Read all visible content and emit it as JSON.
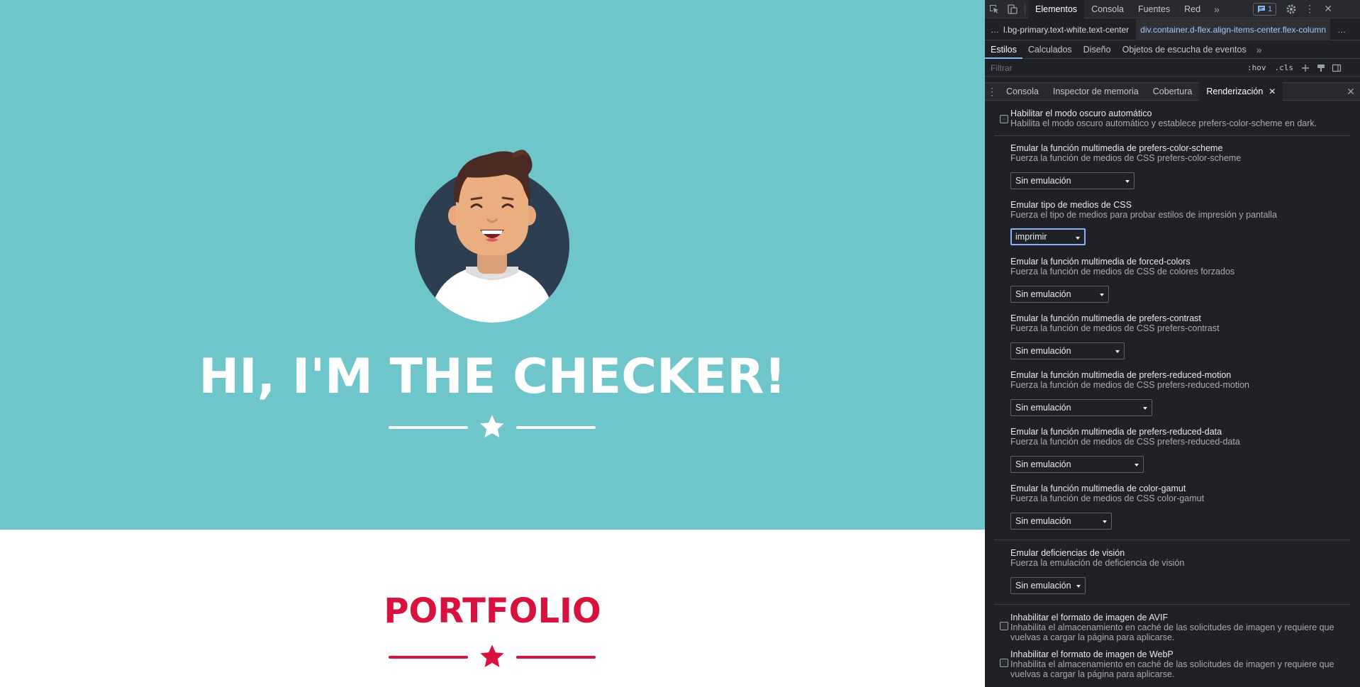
{
  "page": {
    "hero_title": "HI, I'M THE CHECKER!",
    "section_title": "PORTFOLIO",
    "colors": {
      "masthead": "#6ec6ca",
      "accent": "#d7123e",
      "text_light": "#ffffff"
    }
  },
  "devtools": {
    "top_tabs": [
      "Elementos",
      "Consola",
      "Fuentes",
      "Red"
    ],
    "issues_count": "1",
    "breadcrumb": {
      "lead": "…",
      "item1": "l.bg-primary.text-white.text-center",
      "item2": "div.container.d-flex.align-items-center.flex-column",
      "trail": "…"
    },
    "style_tabs": [
      "Estilos",
      "Calculados",
      "Diseño",
      "Objetos de escucha de eventos"
    ],
    "filter_placeholder": "Filtrar",
    "filter_tools": {
      "hov": ":hov",
      "cls": ".cls"
    },
    "drawer_tabs": [
      "Consola",
      "Inspector de memoria",
      "Cobertura",
      "Renderización"
    ],
    "rendering": {
      "auto_dark": {
        "title": "Habilitar el modo oscuro automático",
        "desc": "Habilita el modo oscuro automático y establece prefers-color-scheme en dark."
      },
      "color_scheme": {
        "title": "Emular la función multimedia de prefers-color-scheme",
        "desc": "Fuerza la función de medios de CSS prefers-color-scheme",
        "value": "Sin emulación"
      },
      "media_type": {
        "title": "Emular tipo de medios de CSS",
        "desc": "Fuerza el tipo de medios para probar estilos de impresión y pantalla",
        "value": "imprimir"
      },
      "forced_colors": {
        "title": "Emular la función multimedia de forced-colors",
        "desc": "Fuerza la función de medios de CSS de colores forzados",
        "value": "Sin emulación"
      },
      "contrast": {
        "title": "Emular la función multimedia de prefers-contrast",
        "desc": "Fuerza la función de medios de CSS prefers-contrast",
        "value": "Sin emulación"
      },
      "reduced_motion": {
        "title": "Emular la función multimedia de prefers-reduced-motion",
        "desc": "Fuerza la función de medios de CSS prefers-reduced-motion",
        "value": "Sin emulación"
      },
      "reduced_data": {
        "title": "Emular la función multimedia de prefers-reduced-data",
        "desc": "Fuerza la función de medios de CSS prefers-reduced-data",
        "value": "Sin emulación"
      },
      "color_gamut": {
        "title": "Emular la función multimedia de color-gamut",
        "desc": "Fuerza la función de medios de CSS color-gamut",
        "value": "Sin emulación"
      },
      "vision": {
        "title": "Emular deficiencias de visión",
        "desc": "Fuerza la emulación de deficiencia de visión",
        "value": "Sin emulación"
      },
      "avif": {
        "title": "Inhabilitar el formato de imagen de AVIF",
        "desc": "Inhabilita el almacenamiento en caché de las solicitudes de imagen y requiere que vuelvas a cargar la página para aplicarse."
      },
      "webp": {
        "title": "Inhabilitar el formato de imagen de WebP",
        "desc": "Inhabilita el almacenamiento en caché de las solicitudes de imagen y requiere que vuelvas a cargar la página para aplicarse."
      }
    }
  }
}
